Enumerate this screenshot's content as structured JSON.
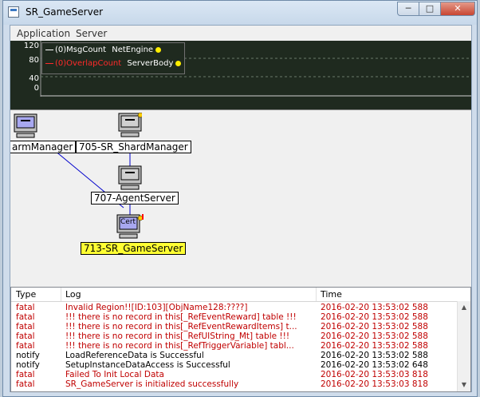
{
  "window": {
    "title": "SR_GameServer",
    "minimize_label": "─",
    "maximize_label": "□",
    "close_label": "✕"
  },
  "menubar": {
    "items": [
      "Application",
      "Server"
    ]
  },
  "graph": {
    "y_ticks": [
      "120",
      "80",
      "40",
      "0"
    ],
    "legend": [
      {
        "prefix": "(0)",
        "name": "MsgCount",
        "source": "NetEngine",
        "color": "#ffffff"
      },
      {
        "prefix": "(0)",
        "name": "OverlapCount",
        "source": "ServerBody",
        "color": "#ff2a2a"
      }
    ]
  },
  "diagram": {
    "nodes": [
      {
        "label": "armManager"
      },
      {
        "label": "705-SR_ShardManager"
      },
      {
        "label": "707-AgentServer"
      },
      {
        "label": "713-SR_GameServer",
        "selected": true,
        "badge": "Cert"
      }
    ]
  },
  "log": {
    "columns": [
      "Type",
      "Log",
      "Time"
    ],
    "colors": {
      "fatal": "#c00000",
      "notify": "#000000"
    },
    "rows": [
      {
        "type": "fatal",
        "text": "Invalid Region!![ID:103][ObjName128:????]",
        "time": "2016-02-20 13:53:02 588"
      },
      {
        "type": "fatal",
        "text": "!!! there is no record in this[_RefEventReward] table !!!",
        "time": "2016-02-20 13:53:02 588"
      },
      {
        "type": "fatal",
        "text": "!!! there is no record in this[_RefEventRewardItems] t...",
        "time": "2016-02-20 13:53:02 588"
      },
      {
        "type": "fatal",
        "text": "!!! there is no record in this[_RefUIString_Mt] table !!!",
        "time": "2016-02-20 13:53:02 588"
      },
      {
        "type": "fatal",
        "text": "!!! there is no record in this[_RefTriggerVariable] tabl...",
        "time": "2016-02-20 13:53:02 588"
      },
      {
        "type": "notify",
        "text": "LoadReferenceData is Successful",
        "time": "2016-02-20 13:53:02 588"
      },
      {
        "type": "notify",
        "text": "SetupInstanceDataAccess is Successful",
        "time": "2016-02-20 13:53:02 648"
      },
      {
        "type": "fatal",
        "text": "Failed To Init Local Data",
        "time": "2016-02-20 13:53:03 818"
      },
      {
        "type": "fatal",
        "text": "SR_GameServer is initialized successfully",
        "time": "2016-02-20 13:53:03 818"
      }
    ]
  }
}
